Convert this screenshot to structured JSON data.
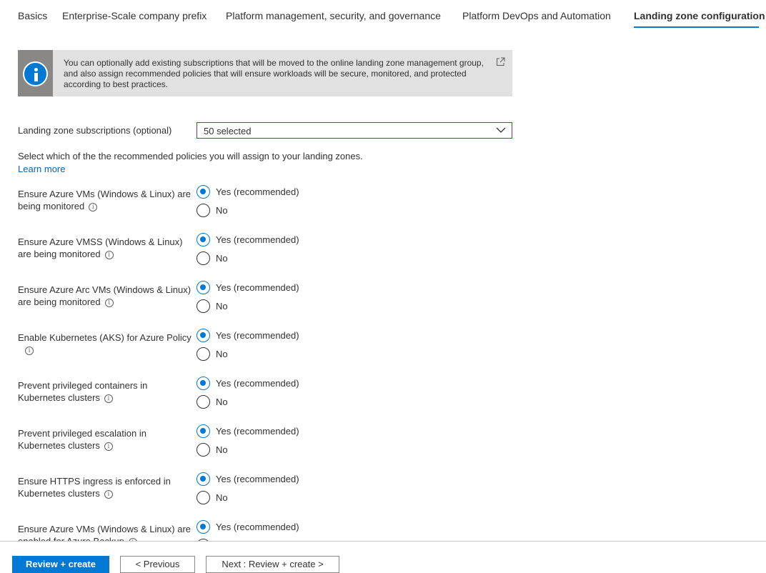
{
  "tabs": [
    {
      "label": "Basics"
    },
    {
      "label": "Enterprise-Scale company prefix"
    },
    {
      "label": "Platform management, security, and governance"
    },
    {
      "label": "Platform DevOps and Automation"
    },
    {
      "label": "Landing zone configuration"
    }
  ],
  "active_tab": "Landing zone configuration",
  "info_banner": {
    "text": "You can optionally add existing subscriptions that will be moved to the online landing zone management group, and also assign recommended policies that will ensure workloads will be secure, monitored, and protected according to best practices.",
    "icon": "info-icon",
    "link_icon": "external-link-icon"
  },
  "subscriptions": {
    "label": "Landing zone subscriptions (optional)",
    "value": "50 selected"
  },
  "policy_intro": "Select which of the the recommended policies you will assign to your landing zones.",
  "learn_more": "Learn more",
  "yes_label": "Yes (recommended)",
  "no_label": "No",
  "info_glyph": "i",
  "policies": [
    {
      "line1": "Ensure Azure VMs (Windows & Linux) are",
      "line2": "being monitored",
      "selected": "yes"
    },
    {
      "line1": "Ensure Azure VMSS (Windows & Linux)",
      "line2": "are being monitored",
      "selected": "yes"
    },
    {
      "line1": "Ensure Azure Arc VMs (Windows & Linux)",
      "line2": "are being monitored",
      "selected": "yes"
    },
    {
      "line1": "Enable Kubernetes (AKS) for Azure Policy",
      "line2": "",
      "selected": "yes"
    },
    {
      "line1": "Prevent privileged containers in",
      "line2": "Kubernetes clusters",
      "selected": "yes"
    },
    {
      "line1": "Prevent privileged escalation in",
      "line2": "Kubernetes clusters",
      "selected": "yes"
    },
    {
      "line1": "Ensure HTTPS ingress is enforced in",
      "line2": "Kubernetes clusters",
      "selected": "yes"
    },
    {
      "line1": "Ensure Azure VMs (Windows & Linux) are",
      "line2": "enabled for Azure Backup",
      "selected": "yes"
    }
  ],
  "footer": {
    "review_create": "Review + create",
    "previous": "< Previous",
    "next": "Next : Review + create >"
  },
  "colors": {
    "accent": "#0078d4",
    "dropdown_border": "#8a2a8a",
    "banner_bg": "#e1e1e1"
  }
}
